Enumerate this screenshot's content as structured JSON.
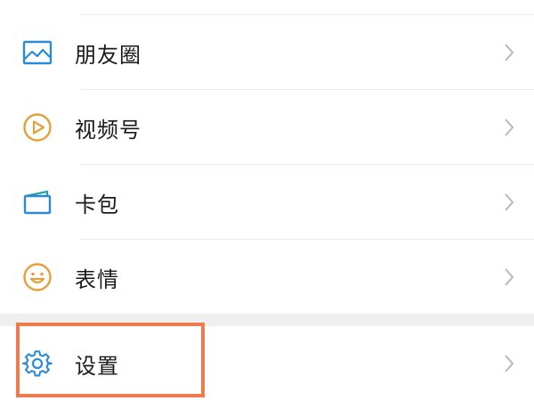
{
  "menu": {
    "items": [
      {
        "label": "朋友圈",
        "icon": "moments-photo-icon",
        "color": "#2a8ad8"
      },
      {
        "label": "视频号",
        "icon": "video-channel-play-icon",
        "color": "#e2a13c"
      },
      {
        "label": "卡包",
        "icon": "card-wallet-icon",
        "color": "#2a8ad8"
      },
      {
        "label": "表情",
        "icon": "sticker-smile-icon",
        "color": "#e2a13c"
      },
      {
        "label": "设置",
        "icon": "settings-gear-icon",
        "color": "#2a8ad8"
      }
    ]
  },
  "colors": {
    "highlight": "#ef7a4c",
    "chevron": "#b8b8b8",
    "divider": "#ececec",
    "section_gap": "#efefef"
  }
}
